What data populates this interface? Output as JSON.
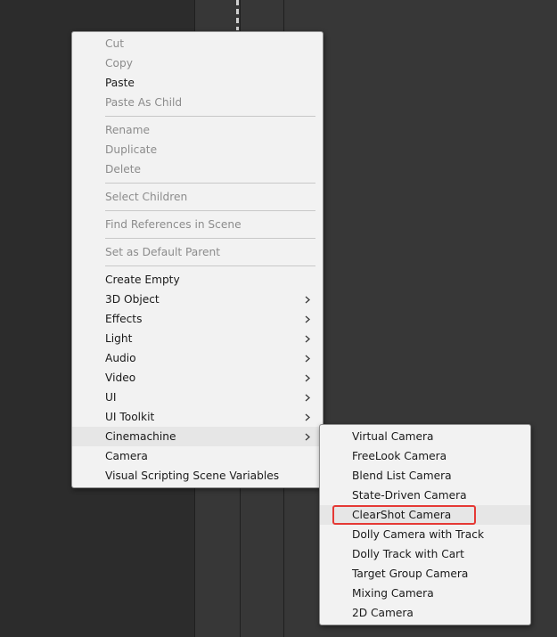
{
  "context_menu": {
    "items": [
      {
        "label": "Cut",
        "enabled": false,
        "submenu": false
      },
      {
        "label": "Copy",
        "enabled": false,
        "submenu": false
      },
      {
        "label": "Paste",
        "enabled": true,
        "submenu": false
      },
      {
        "label": "Paste As Child",
        "enabled": false,
        "submenu": false
      },
      {
        "label": "Rename",
        "enabled": false,
        "submenu": false
      },
      {
        "label": "Duplicate",
        "enabled": false,
        "submenu": false
      },
      {
        "label": "Delete",
        "enabled": false,
        "submenu": false
      },
      {
        "label": "Select Children",
        "enabled": false,
        "submenu": false
      },
      {
        "label": "Find References in Scene",
        "enabled": false,
        "submenu": false
      },
      {
        "label": "Set as Default Parent",
        "enabled": false,
        "submenu": false
      },
      {
        "label": "Create Empty",
        "enabled": true,
        "submenu": false
      },
      {
        "label": "3D Object",
        "enabled": true,
        "submenu": true
      },
      {
        "label": "Effects",
        "enabled": true,
        "submenu": true
      },
      {
        "label": "Light",
        "enabled": true,
        "submenu": true
      },
      {
        "label": "Audio",
        "enabled": true,
        "submenu": true
      },
      {
        "label": "Video",
        "enabled": true,
        "submenu": true
      },
      {
        "label": "UI",
        "enabled": true,
        "submenu": true
      },
      {
        "label": "UI Toolkit",
        "enabled": true,
        "submenu": true
      },
      {
        "label": "Cinemachine",
        "enabled": true,
        "submenu": true,
        "hovered": true
      },
      {
        "label": "Camera",
        "enabled": true,
        "submenu": false
      },
      {
        "label": "Visual Scripting Scene Variables",
        "enabled": true,
        "submenu": false
      }
    ]
  },
  "cinemachine_submenu": {
    "items": [
      {
        "label": "Virtual Camera"
      },
      {
        "label": "FreeLook Camera"
      },
      {
        "label": "Blend List Camera"
      },
      {
        "label": "State-Driven Camera"
      },
      {
        "label": "ClearShot Camera",
        "hovered": true,
        "highlighted": true
      },
      {
        "label": "Dolly Camera with Track"
      },
      {
        "label": "Dolly Track with Cart"
      },
      {
        "label": "Target Group Camera"
      },
      {
        "label": "Mixing Camera"
      },
      {
        "label": "2D Camera"
      }
    ]
  },
  "icons": {
    "submenu_arrow": "chevron-right-icon"
  },
  "colors": {
    "menu_background": "#f2f2f2",
    "text_enabled": "#1a1a1a",
    "text_disabled": "#8c8c8c",
    "hover_background": "#e6e6e6",
    "highlight_border": "#e53935",
    "editor_background": "#373737"
  }
}
